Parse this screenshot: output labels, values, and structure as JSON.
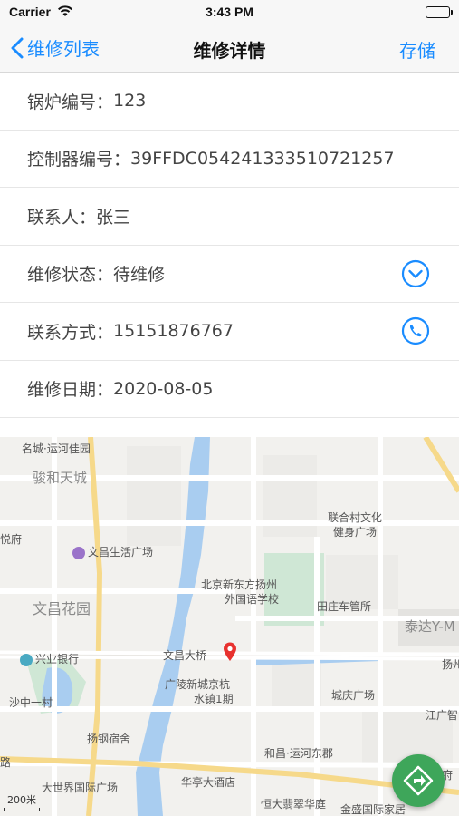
{
  "status_bar": {
    "carrier": "Carrier",
    "time": "3:43 PM"
  },
  "nav": {
    "back_label": "维修列表",
    "title": "维修详情",
    "save_label": "存储"
  },
  "form": {
    "boiler_no": {
      "label": "锅炉编号：",
      "value": "123"
    },
    "controller_no": {
      "label": "控制器编号：",
      "value": "39FFDC054241333510721257"
    },
    "contact_person": {
      "label": "联系人：",
      "value": "张三"
    },
    "repair_status": {
      "label": "维修状态：",
      "value": "待维修"
    },
    "contact_phone": {
      "label": "联系方式：",
      "value": " 15151876767"
    },
    "repair_date": {
      "label": "维修日期：",
      "value": "2020-08-05"
    }
  },
  "map": {
    "labels": {
      "l1": "名城·运河佳园",
      "l2": "骏和天城",
      "l3": "联合村文化",
      "l3b": "健身广场",
      "l4": "悦府",
      "l5": "文昌生活广场",
      "l6": "北京新东方扬州",
      "l6b": "外国语学校",
      "l7": "田庄车管所",
      "l8": "文昌花园",
      "l9": "泰达Y-M",
      "l10": "兴业银行",
      "l11": "文昌大桥",
      "l12": "扬州",
      "l13": "广陵新城京杭",
      "l13b": "水镇1期",
      "l14": "城庆广场",
      "l15": "沙中一村",
      "l16": "江广智",
      "l17": "扬钢宿舍",
      "l18": "和昌·运河东郡",
      "l19": "路",
      "l20": "华府",
      "l21": "大世界国际广场",
      "l22": "华亭大酒店",
      "l23": "恒大翡翠华庭",
      "l24": "金盛国际家居",
      "scale": "200米"
    },
    "colors": {
      "water": "#a9cdf0",
      "road_major": "#f6d98a",
      "park": "#cfe7d5",
      "fab": "#3ea65a"
    }
  }
}
